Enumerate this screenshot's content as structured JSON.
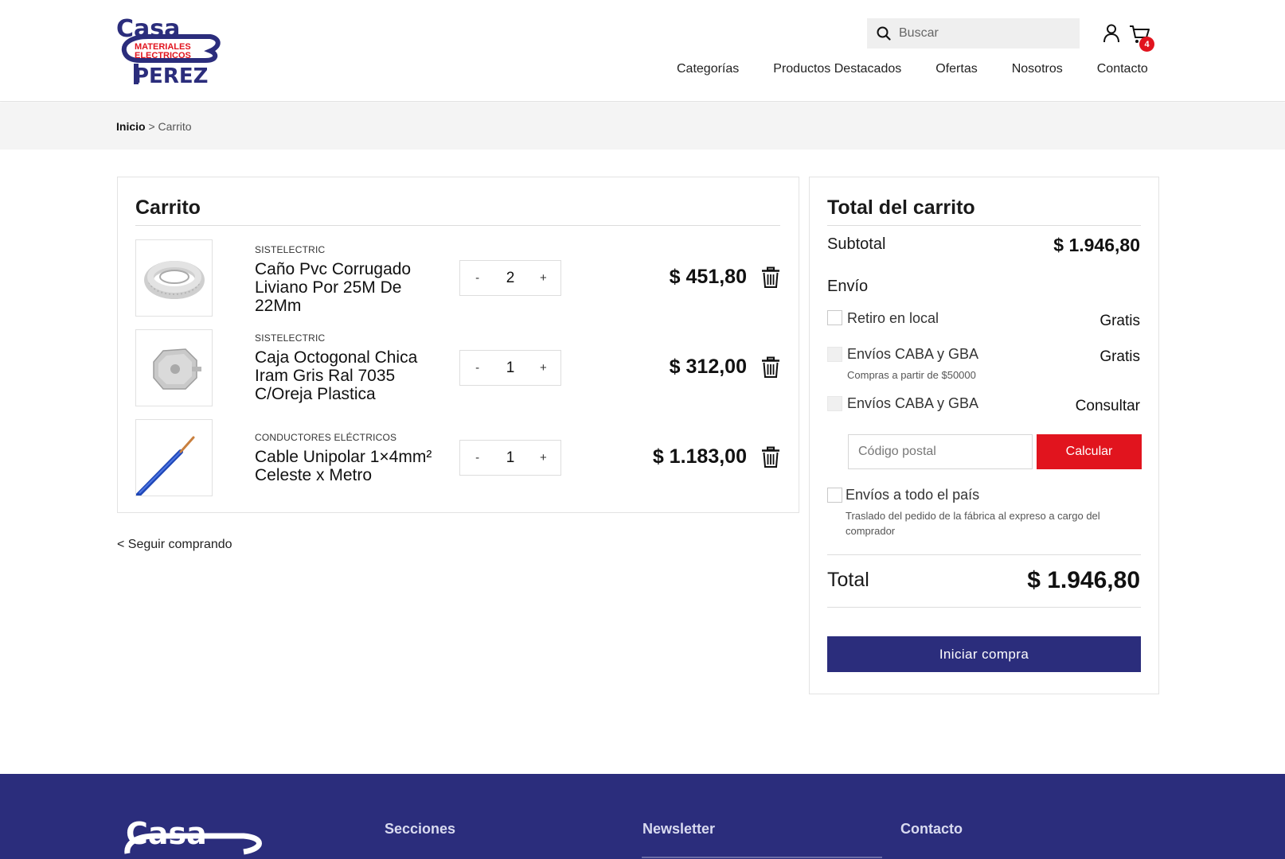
{
  "brand": {
    "logo_top": "Casa",
    "logo_mid1": "MATERIALES",
    "logo_mid2": "ELECTRICOS",
    "logo_bottom": "PEREZ",
    "primary_color": "#2b2d7c",
    "accent_color": "#e1141e"
  },
  "header": {
    "search_placeholder": "Buscar",
    "cart_count": "4",
    "nav": [
      "Categorías",
      "Productos Destacados",
      "Ofertas",
      "Nosotros",
      "Contacto"
    ]
  },
  "breadcrumb": {
    "home": "Inicio",
    "separator": ">",
    "current": "Carrito"
  },
  "cart": {
    "title": "Carrito",
    "items": [
      {
        "brand": "SISTELECTRIC",
        "name": "Caño Pvc Corrugado Liviano Por 25M De 22Mm",
        "quantity": "2",
        "price": "$ 451,80",
        "image": "corrugated-pipe-coil"
      },
      {
        "brand": "SISTELECTRIC",
        "name": "Caja Octogonal Chica Iram Gris Ral 7035 C/Oreja Plastica",
        "quantity": "1",
        "price": "$ 312,00",
        "image": "octagonal-junction-box"
      },
      {
        "brand": "CONDUCTORES ELÉCTRICOS",
        "name": "Cable Unipolar 1×4mm² Celeste x Metro",
        "quantity": "1",
        "price": "$ 1.183,00",
        "image": "blue-cable"
      }
    ],
    "minus_label": "-",
    "plus_label": "+",
    "continue_label": "< Seguir comprando"
  },
  "summary": {
    "title": "Total del carrito",
    "subtotal_label": "Subtotal",
    "subtotal_value": "$ 1.946,80",
    "shipping_label": "Envío",
    "options": [
      {
        "label": "Retiro en local",
        "sub": "",
        "value": "Gratis"
      },
      {
        "label": "Envíos CABA y GBA",
        "sub": "Compras a partir de $50000",
        "value": "Gratis"
      },
      {
        "label": "Envíos CABA y GBA",
        "sub": "",
        "value": "Consultar"
      }
    ],
    "zip_placeholder": "Código postal",
    "calc_label": "Calcular",
    "country_label": "Envíos a todo el país",
    "country_sub": "Traslado del pedido de la fábrica al expreso a cargo del comprador",
    "total_label": "Total",
    "total_value": "$ 1.946,80",
    "checkout_label": "Iniciar compra"
  },
  "footer": {
    "logo_text": "Casa",
    "sections_heading": "Secciones",
    "newsletter_heading": "Newsletter",
    "contact_heading": "Contacto"
  }
}
